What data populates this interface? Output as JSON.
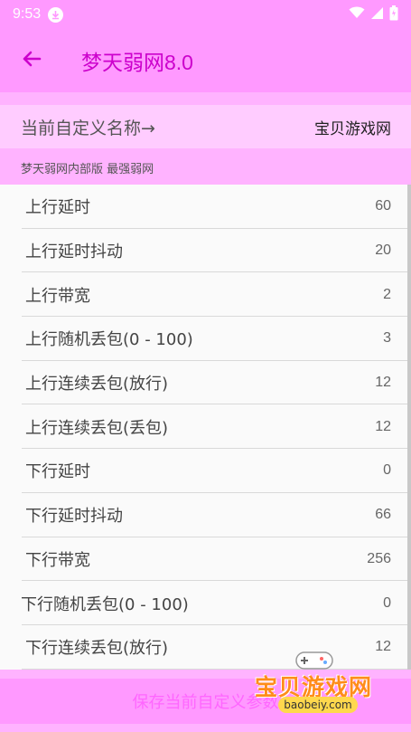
{
  "status_bar": {
    "time": "9:53"
  },
  "toolbar": {
    "title": "梦天弱网8.0"
  },
  "custom_name": {
    "label": "当前自定义名称→",
    "value": "宝贝游戏网"
  },
  "group": {
    "header": "梦天弱网内部版  最强弱网"
  },
  "settings": [
    {
      "label": "上行延时",
      "value": "60"
    },
    {
      "label": "上行延时抖动",
      "value": "20"
    },
    {
      "label": "上行带宽",
      "value": "2"
    },
    {
      "label": "上行随机丢包(0 - 100)",
      "value": "3"
    },
    {
      "label": "上行连续丢包(放行)",
      "value": "12"
    },
    {
      "label": "上行连续丢包(丢包)",
      "value": "12"
    },
    {
      "label": "下行延时",
      "value": "0"
    },
    {
      "label": "下行延时抖动",
      "value": "66"
    },
    {
      "label": "下行带宽",
      "value": "256"
    },
    {
      "label": "下行随机丢包(0 - 100)",
      "value": "0"
    },
    {
      "label": "下行连续丢包(放行)",
      "value": "12"
    }
  ],
  "bottom": {
    "save_label": "保存当前自定义参数"
  },
  "watermark": {
    "name": "宝贝游戏网",
    "url": "baobeiy.com"
  },
  "colors": {
    "accent": "#cc00cc",
    "bar": "#ff99ff",
    "light": "#ffccff"
  }
}
